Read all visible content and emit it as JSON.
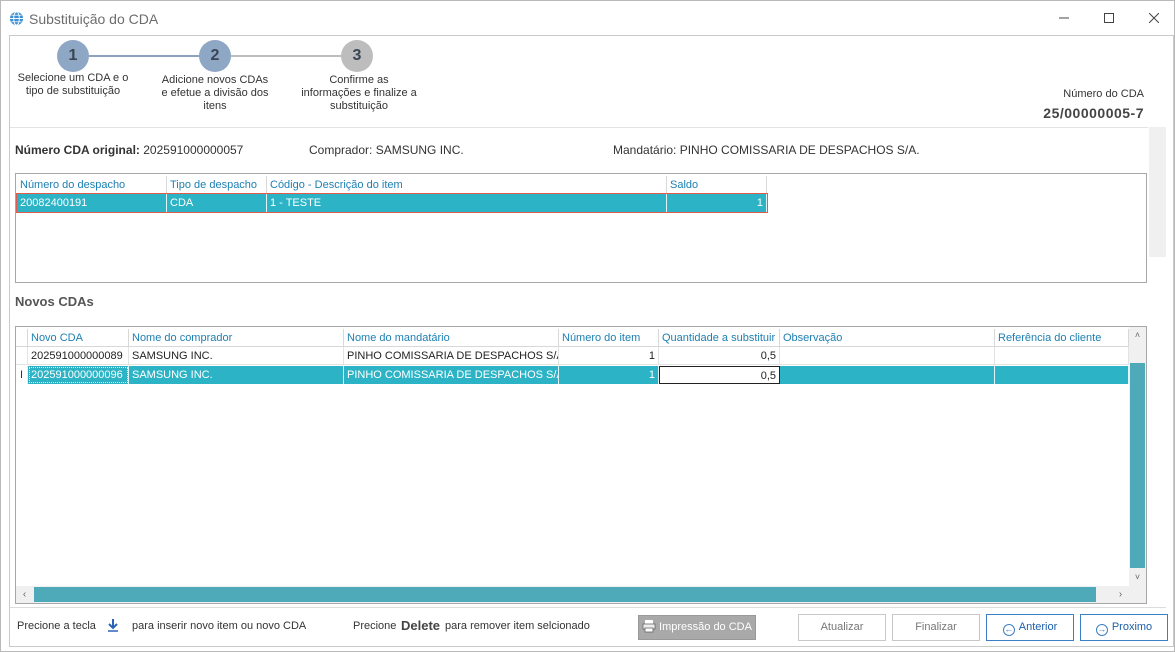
{
  "window": {
    "title": "Substituição do CDA"
  },
  "wizard": {
    "steps": [
      {
        "number": "1",
        "label": "Selecione um CDA e o tipo de substituição"
      },
      {
        "number": "2",
        "label": "Adicione novos CDAs e efetue a divisão dos itens"
      },
      {
        "number": "3",
        "label": "Confirme as informações e finalize a substituição"
      }
    ],
    "cda_label": "Número do CDA",
    "cda_value": "25/00000005-7"
  },
  "info": {
    "original_label": "Número CDA original:",
    "original_value": "202591000000057",
    "buyer_label": "Comprador:",
    "buyer_value": "SAMSUNG INC.",
    "agent_label": "Mandatário:",
    "agent_value": "PINHO COMISSARIA DE DESPACHOS S/A."
  },
  "original_grid": {
    "headers": [
      "Número do despacho",
      "Tipo de despacho",
      "Código - Descrição do item",
      "Saldo"
    ],
    "rows": [
      [
        "20082400191",
        "CDA",
        "1 - TESTE",
        "1"
      ]
    ]
  },
  "new_section_title": "Novos CDAs",
  "new_grid": {
    "headers": [
      "Novo CDA",
      "Nome do comprador",
      "Nome do mandatário",
      "Número do item",
      "Quantidade a substituir",
      "Observação",
      "Referência do cliente"
    ],
    "rows": [
      [
        "202591000000089",
        "SAMSUNG INC.",
        "PINHO COMISSARIA DE DESPACHOS S/A.",
        "1",
        "0,5",
        "",
        ""
      ],
      [
        "202591000000096",
        "SAMSUNG INC.",
        "PINHO COMISSARIA DE DESPACHOS S/A.",
        "1",
        "0,5",
        "",
        ""
      ]
    ],
    "row_indicator": "I"
  },
  "footer": {
    "hint1_pre": "Precione a tecla",
    "hint1_post": "para inserir novo item ou novo CDA",
    "hint2_pre": "Precione",
    "hint2_key": "Delete",
    "hint2_post": "para remover item selcionado",
    "print_label": "Impressão do CDA",
    "refresh_label": "Atualizar",
    "finish_label": "Finalizar",
    "prev_label": "Anterior",
    "next_label": "Proximo"
  },
  "colors": {
    "selection": "#2cb4c6",
    "header_text": "#1c7fb3",
    "accent": "#3b7fc4"
  }
}
